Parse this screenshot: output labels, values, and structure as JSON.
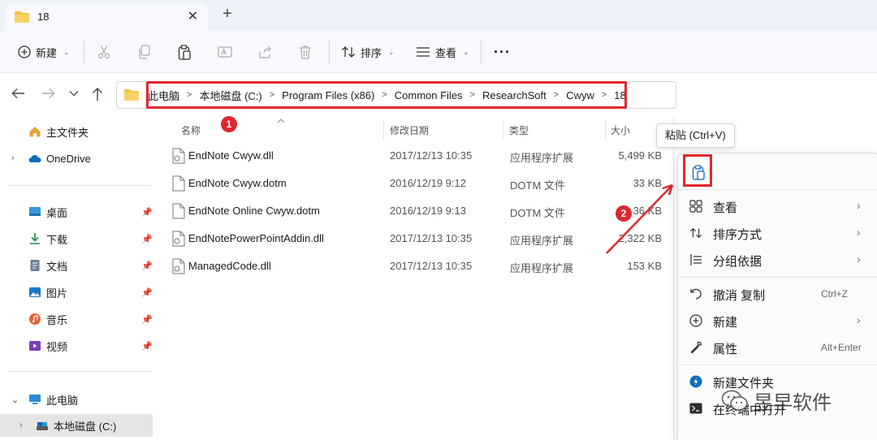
{
  "tab": {
    "title": "18",
    "close": "✕",
    "new_tab": "+"
  },
  "toolbar": {
    "new_label": "新建",
    "sort_label": "排序",
    "view_label": "查看",
    "more": "···"
  },
  "address": {
    "crumbs": [
      "此电脑",
      "本地磁盘 (C:)",
      "Program Files (x86)",
      "Common Files",
      "ResearchSoft",
      "Cwyw",
      "18"
    ]
  },
  "sidebar": {
    "items": [
      {
        "label": "主文件夹"
      },
      {
        "label": "OneDrive"
      },
      {
        "label": "桌面"
      },
      {
        "label": "下载"
      },
      {
        "label": "文档"
      },
      {
        "label": "图片"
      },
      {
        "label": "音乐"
      },
      {
        "label": "视频"
      },
      {
        "label": "此电脑"
      },
      {
        "label": "本地磁盘 (C:)"
      }
    ]
  },
  "columns": {
    "name": "名称",
    "date": "修改日期",
    "type": "类型",
    "size": "大小"
  },
  "files": [
    {
      "name": "EndNote Cwyw.dll",
      "date": "2017/12/13 10:35",
      "type": "应用程序扩展",
      "size": "5,499 KB"
    },
    {
      "name": "EndNote Cwyw.dotm",
      "date": "2016/12/19 9:12",
      "type": "DOTM 文件",
      "size": "33 KB"
    },
    {
      "name": "EndNote Online Cwyw.dotm",
      "date": "2016/12/19 9:13",
      "type": "DOTM 文件",
      "size": "36 KB"
    },
    {
      "name": "EndNotePowerPointAddin.dll",
      "date": "2017/12/13 10:35",
      "type": "应用程序扩展",
      "size": "2,322 KB"
    },
    {
      "name": "ManagedCode.dll",
      "date": "2017/12/13 10:35",
      "type": "应用程序扩展",
      "size": "153 KB"
    }
  ],
  "annotations": {
    "badge1": "1",
    "badge2": "2"
  },
  "tooltip": "粘贴 (Ctrl+V)",
  "context_menu": {
    "items": [
      {
        "label": "查看",
        "shortcut": "",
        "arrow": "›"
      },
      {
        "label": "排序方式",
        "shortcut": "",
        "arrow": "›"
      },
      {
        "label": "分组依据",
        "shortcut": "",
        "arrow": "›"
      },
      {
        "label": "撤消 复制",
        "shortcut": "Ctrl+Z",
        "arrow": ""
      },
      {
        "label": "新建",
        "shortcut": "",
        "arrow": "›"
      },
      {
        "label": "属性",
        "shortcut": "Alt+Enter",
        "arrow": ""
      },
      {
        "label": "新建文件夹",
        "shortcut": "",
        "arrow": ""
      },
      {
        "label": "在终端中打开",
        "shortcut": "",
        "arrow": ""
      }
    ]
  },
  "watermark": "昱早软件",
  "colors": {
    "accent": "#0067c0",
    "annotation_red": "#e0282e",
    "folder_yellow": "#f3c343"
  }
}
